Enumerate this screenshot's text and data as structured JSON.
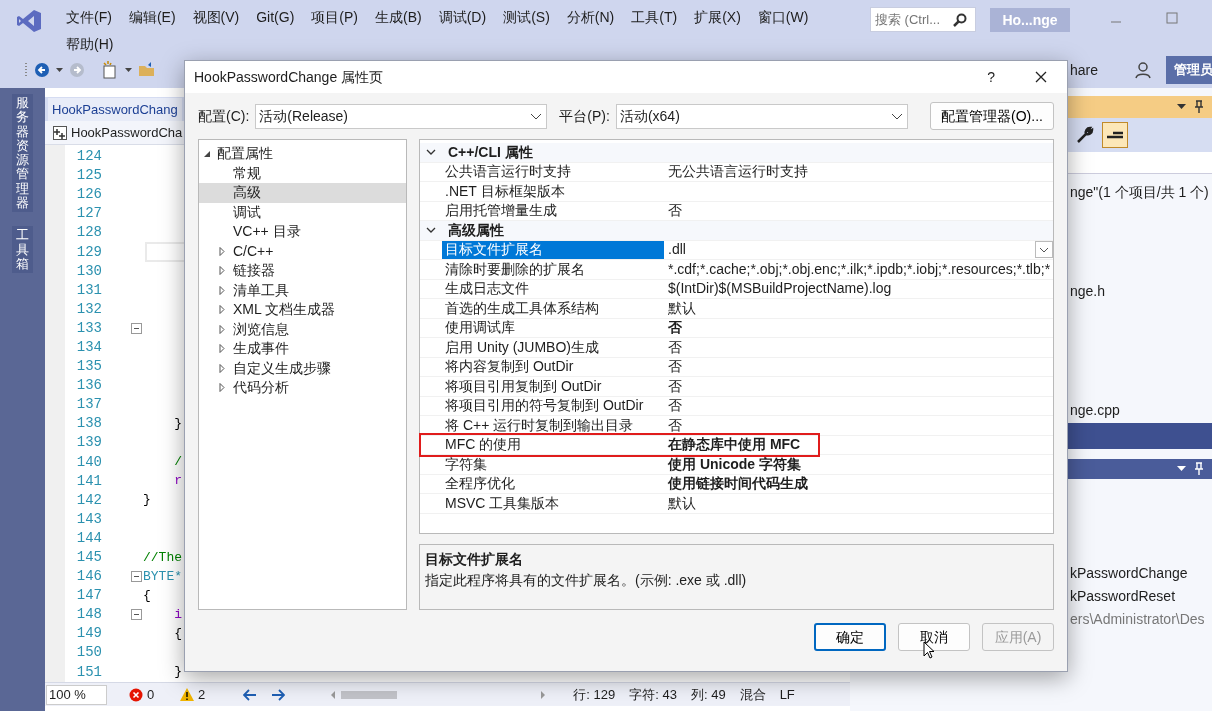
{
  "ide": {
    "menus": [
      "文件(F)",
      "编辑(E)",
      "视图(V)",
      "Git(G)",
      "项目(P)",
      "生成(B)",
      "调试(D)",
      "测试(S)",
      "分析(N)",
      "工具(T)",
      "扩展(X)",
      "窗口(W)",
      "帮助(H)"
    ],
    "search": {
      "placeholder": "搜索 (Ctrl..."
    },
    "solution_title": "Ho...nge",
    "share": "hare",
    "admin": "管理员"
  },
  "side_tabs": [
    "服务器资源管理器",
    "工具箱"
  ],
  "editor": {
    "tab": "HookPasswordChang",
    "nav": "HookPasswordCha",
    "lines": [
      {
        "number": "124",
        "fold": false,
        "current": false
      },
      {
        "number": "125",
        "fold": false,
        "current": false
      },
      {
        "number": "126",
        "fold": false,
        "current": false
      },
      {
        "number": "127",
        "fold": false,
        "current": false
      },
      {
        "number": "128",
        "fold": false,
        "current": false
      },
      {
        "number": "129",
        "fold": false,
        "current": true
      },
      {
        "number": "130",
        "fold": false,
        "current": false
      },
      {
        "number": "131",
        "fold": false,
        "current": false
      },
      {
        "number": "132",
        "fold": false,
        "current": false
      },
      {
        "number": "133",
        "fold": true,
        "current": false
      },
      {
        "number": "134",
        "fold": false,
        "current": false
      },
      {
        "number": "135",
        "fold": false,
        "current": false
      },
      {
        "number": "136",
        "fold": false,
        "current": false
      },
      {
        "number": "137",
        "fold": false,
        "current": false
      },
      {
        "number": "138",
        "code": "    }",
        "kind": "plain",
        "fold": false,
        "current": false
      },
      {
        "number": "139",
        "fold": false,
        "current": false
      },
      {
        "number": "140",
        "code": "    /",
        "kind": "comment",
        "fold": false,
        "current": false
      },
      {
        "number": "141",
        "code": "    r",
        "kind": "keyword",
        "fold": false,
        "current": false
      },
      {
        "number": "142",
        "code": "}",
        "kind": "plain",
        "fold": false,
        "current": false
      },
      {
        "number": "143",
        "fold": false,
        "current": false
      },
      {
        "number": "144",
        "fold": false,
        "current": false
      },
      {
        "number": "145",
        "code": "//The",
        "kind": "comment",
        "fold": false,
        "current": false
      },
      {
        "number": "146",
        "code": "BYTE*",
        "kind": "type",
        "fold": true,
        "current": false
      },
      {
        "number": "147",
        "code": "{",
        "kind": "plain",
        "fold": false,
        "current": false
      },
      {
        "number": "148",
        "code": "    i",
        "kind": "keyword",
        "fold": true,
        "current": false
      },
      {
        "number": "149",
        "code": "    {",
        "kind": "plain",
        "fold": false,
        "current": false
      },
      {
        "number": "150",
        "fold": false,
        "current": false
      },
      {
        "number": "151",
        "code": "    }",
        "kind": "plain",
        "fold": false,
        "current": false
      }
    ],
    "status": {
      "zoom": "100 %",
      "errors": "0",
      "warnings": "2",
      "line": "行: 129",
      "char": "字符: 43",
      "col": "列: 49",
      "encoding": "混合",
      "eol": "LF"
    }
  },
  "right_panel": {
    "summary": "nge\"(1 个项目/共 1 个)",
    "files": [
      "nge.h",
      "nge.cpp"
    ],
    "rows": [
      "kPasswordChange",
      "kPasswordReset",
      "ers\\Administrator\\Des"
    ]
  },
  "dialog": {
    "title": "HookPasswordChange 属性页",
    "help": "?",
    "config_label": "配置(C):",
    "config_value": "活动(Release)",
    "platform_label": "平台(P):",
    "platform_value": "活动(x64)",
    "manager_button": "配置管理器(O)...",
    "tree": [
      {
        "label": "配置属性",
        "expandable": true,
        "expanded": true,
        "selected": false,
        "children": [
          {
            "label": "常规",
            "expandable": false,
            "selected": false
          },
          {
            "label": "高级",
            "expandable": false,
            "selected": true
          },
          {
            "label": "调试",
            "expandable": false,
            "selected": false
          },
          {
            "label": "VC++ 目录",
            "expandable": false,
            "selected": false
          },
          {
            "label": "C/C++",
            "expandable": true,
            "expanded": false,
            "selected": false
          },
          {
            "label": "链接器",
            "expandable": true,
            "expanded": false,
            "selected": false
          },
          {
            "label": "清单工具",
            "expandable": true,
            "expanded": false,
            "selected": false
          },
          {
            "label": "XML 文档生成器",
            "expandable": true,
            "expanded": false,
            "selected": false
          },
          {
            "label": "浏览信息",
            "expandable": true,
            "expanded": false,
            "selected": false
          },
          {
            "label": "生成事件",
            "expandable": true,
            "expanded": false,
            "selected": false
          },
          {
            "label": "自定义生成步骤",
            "expandable": true,
            "expanded": false,
            "selected": false
          },
          {
            "label": "代码分析",
            "expandable": true,
            "expanded": false,
            "selected": false
          }
        ]
      }
    ],
    "categories": [
      {
        "label": "C++/CLI 属性",
        "expanded": true,
        "rows": [
          {
            "name": "公共语言运行时支持",
            "value": "无公共语言运行时支持",
            "bold": false,
            "selected": false,
            "highlighted": false
          },
          {
            "name": ".NET 目标框架版本",
            "selected": false,
            "highlighted": false
          },
          {
            "name": "启用托管增量生成",
            "value": "否",
            "bold": false,
            "selected": false,
            "highlighted": false
          }
        ]
      },
      {
        "label": "高级属性",
        "expanded": true,
        "rows": [
          {
            "name": "目标文件扩展名",
            "value": ".dll",
            "bold": false,
            "selected": true,
            "highlighted": false
          },
          {
            "name": "清除时要删除的扩展名",
            "value": "*.cdf;*.cache;*.obj;*.obj.enc;*.ilk;*.ipdb;*.iobj;*.resources;*.tlb;*",
            "bold": false,
            "selected": false,
            "highlighted": false
          },
          {
            "name": "生成日志文件",
            "value": "$(IntDir)$(MSBuildProjectName).log",
            "bold": false,
            "selected": false,
            "highlighted": false
          },
          {
            "name": "首选的生成工具体系结构",
            "value": "默认",
            "bold": false,
            "selected": false,
            "highlighted": false
          },
          {
            "name": "使用调试库",
            "value": "否",
            "bold": true,
            "selected": false,
            "highlighted": false
          },
          {
            "name": "启用 Unity (JUMBO)生成",
            "value": "否",
            "bold": false,
            "selected": false,
            "highlighted": false
          },
          {
            "name": "将内容复制到 OutDir",
            "value": "否",
            "bold": false,
            "selected": false,
            "highlighted": false
          },
          {
            "name": "将项目引用复制到 OutDir",
            "value": "否",
            "bold": false,
            "selected": false,
            "highlighted": false
          },
          {
            "name": "将项目引用的符号复制到 OutDir",
            "value": "否",
            "bold": false,
            "selected": false,
            "highlighted": false
          },
          {
            "name": "将 C++ 运行时复制到输出目录",
            "value": "否",
            "bold": false,
            "selected": false,
            "highlighted": false
          },
          {
            "name": "MFC 的使用",
            "value": "在静态库中使用 MFC",
            "bold": true,
            "selected": false,
            "highlighted": true
          },
          {
            "name": "字符集",
            "value": "使用 Unicode 字符集",
            "bold": true,
            "selected": false,
            "highlighted": false
          },
          {
            "name": "全程序优化",
            "value": "使用链接时间代码生成",
            "bold": true,
            "selected": false,
            "highlighted": false
          },
          {
            "name": "MSVC 工具集版本",
            "value": "默认",
            "bold": false,
            "selected": false,
            "highlighted": false
          }
        ]
      }
    ],
    "description": {
      "title": "目标文件扩展名",
      "text": "指定此程序将具有的文件扩展名。(示例: .exe 或 .dll)"
    },
    "buttons": [
      {
        "label": "确定",
        "default": true,
        "disabled": false
      },
      {
        "label": "取消",
        "default": false,
        "disabled": false
      },
      {
        "label": "应用(A)",
        "default": false,
        "disabled": true
      }
    ]
  }
}
